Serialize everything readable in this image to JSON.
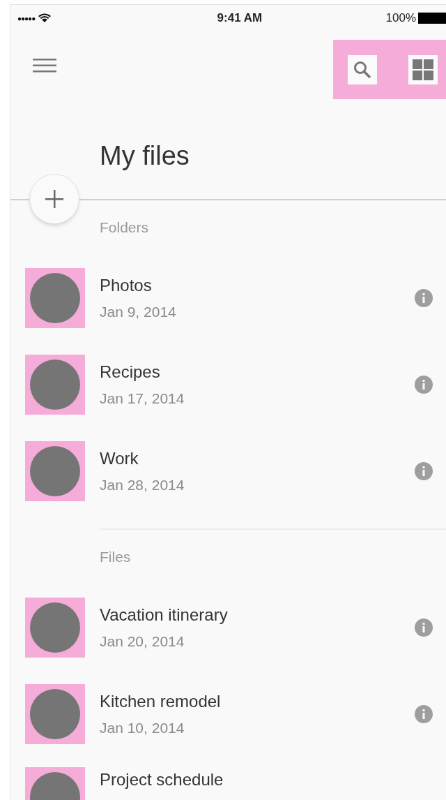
{
  "status_bar": {
    "signal": "●●●●●",
    "time": "9:41 AM",
    "battery": "100%"
  },
  "title": "My files",
  "sections": [
    {
      "label": "Folders",
      "items": [
        {
          "name": "Photos",
          "date": "Jan 9, 2014"
        },
        {
          "name": "Recipes",
          "date": "Jan 17, 2014"
        },
        {
          "name": "Work",
          "date": "Jan 28, 2014"
        }
      ]
    },
    {
      "label": "Files",
      "items": [
        {
          "name": "Vacation itinerary",
          "date": "Jan 20, 2014"
        },
        {
          "name": "Kitchen remodel",
          "date": "Jan 10, 2014"
        },
        {
          "name": "Project schedule"
        }
      ]
    }
  ]
}
